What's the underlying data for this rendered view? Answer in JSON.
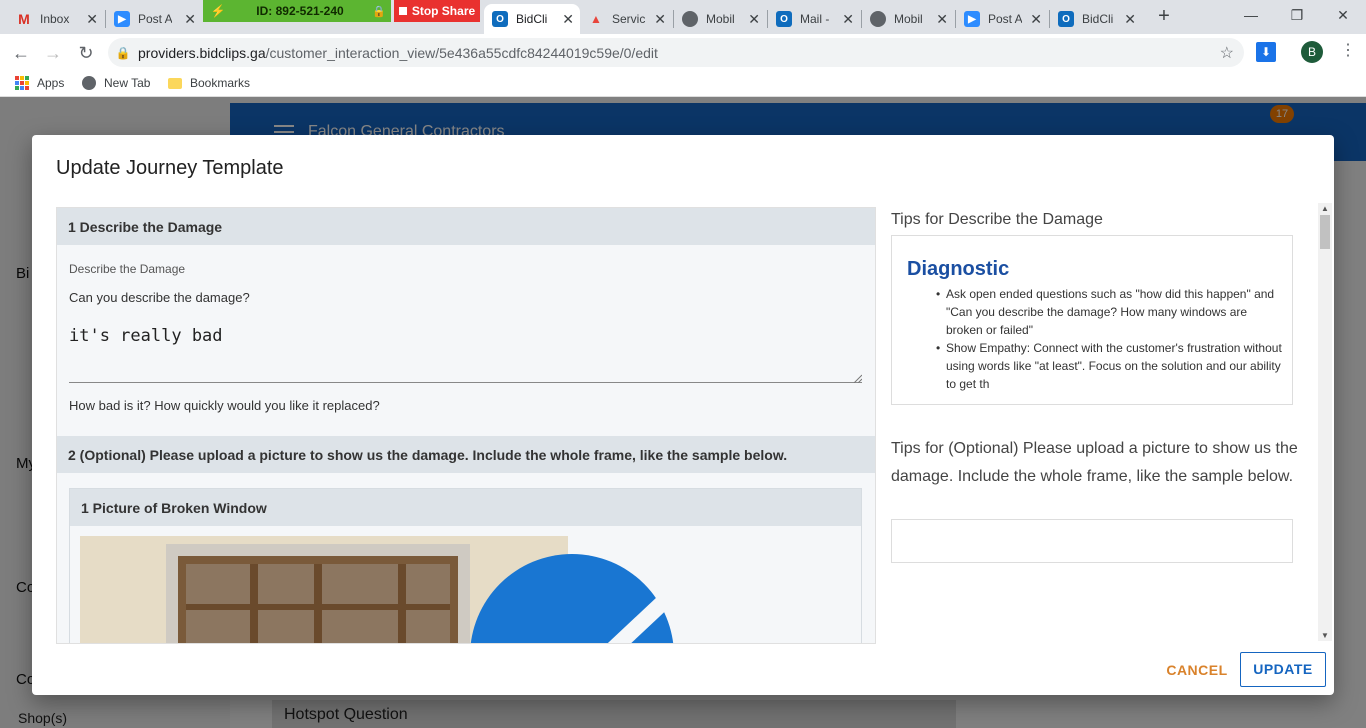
{
  "browser": {
    "tabs": [
      {
        "title": "Inbox",
        "icon": "gmail-icon",
        "color": "#d93025"
      },
      {
        "title": "Post A",
        "icon": "zoom-icon",
        "color": "#2d8cff"
      },
      {
        "title": "BidCli",
        "icon": "outlook-icon",
        "color": "#0f6cbd"
      },
      {
        "title": "Servic",
        "icon": "servicetitan-icon",
        "color": "#e8453c"
      },
      {
        "title": "Mobil",
        "icon": "globe-icon",
        "color": "#5f6368"
      },
      {
        "title": "Mail -",
        "icon": "outlook-icon",
        "color": "#0f6cbd"
      },
      {
        "title": "Mobil",
        "icon": "globe-icon",
        "color": "#5f6368"
      },
      {
        "title": "Post A",
        "icon": "zoom-icon",
        "color": "#2d8cff"
      },
      {
        "title": "BidCli",
        "icon": "outlook-icon",
        "color": "#0f6cbd"
      }
    ],
    "zoom_meeting_id": "ID: 892-521-240",
    "stop_share_label": "Stop Share",
    "url_host": "providers.bidclips.ga",
    "url_path": "/customer_interaction_view/5e436a55cdfc84244019c59e/0/edit",
    "profile_initial": "B",
    "bookmarks": [
      {
        "label": "Apps",
        "icon": "apps-grid-icon"
      },
      {
        "label": "New Tab",
        "icon": "globe-icon"
      },
      {
        "label": "Bookmarks",
        "icon": "folder-icon"
      }
    ]
  },
  "app": {
    "brand": "Falcon General Contractors",
    "notification_count": "17",
    "sidebar_fragments": [
      "Bi",
      "My",
      "Co",
      "Co"
    ],
    "hotspot_label": "Hotspot Question",
    "shops_label": "Shop(s)"
  },
  "modal": {
    "title": "Update Journey Template",
    "section1": {
      "header": "1 Describe the Damage",
      "field_label": "Describe the Damage",
      "question": "Can you describe the damage?",
      "answer": "it's really bad",
      "hint": "How bad is it? How quickly would you like it replaced?"
    },
    "section2": {
      "header": "2 (Optional) Please upload a picture to show us the damage. Include the whole frame, like the sample below.",
      "picture_header": "1 Picture of Broken Window"
    },
    "tips1": {
      "title": "Tips for Describe the Damage",
      "heading": "Diagnostic",
      "items": [
        "Ask open ended questions such as \"how did this happen\" and \"Can you describe the damage? How many windows are broken or failed\"",
        "Show Empathy: Connect with the customer's frustration without using words like \"at least\". Focus on the solution and our ability to get th"
      ]
    },
    "tips2": {
      "title": "Tips for (Optional) Please upload a picture to show us the damage. Include the whole frame, like the sample below."
    },
    "cancel_label": "CANCEL",
    "update_label": "UPDATE"
  }
}
